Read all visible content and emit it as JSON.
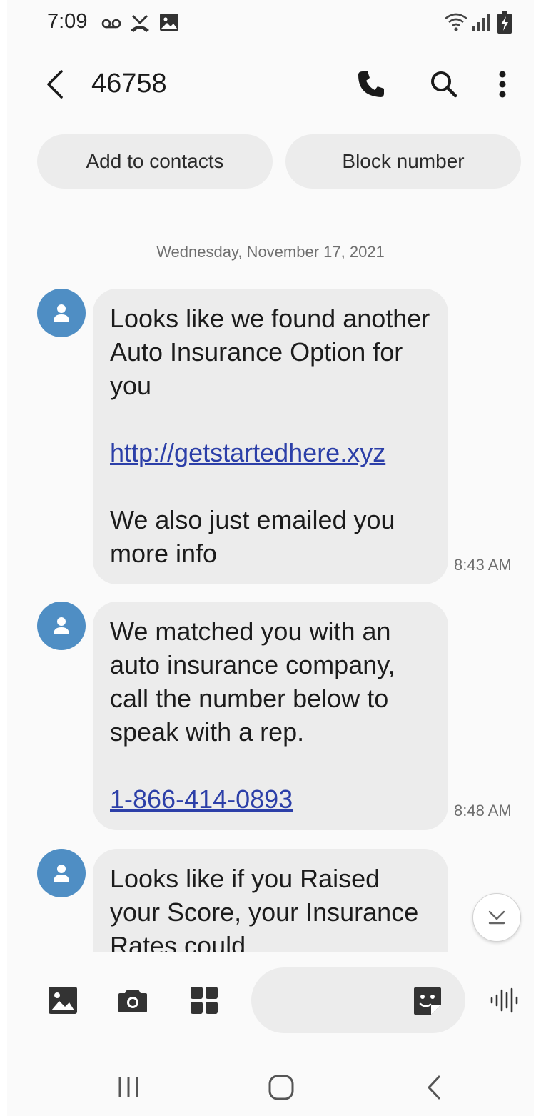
{
  "status_bar": {
    "time": "7:09",
    "icons": [
      "voicemail-icon",
      "missed-call-icon",
      "gallery-icon",
      "wifi-icon",
      "signal-icon",
      "battery-charging-icon"
    ]
  },
  "header": {
    "title": "46758",
    "icons": [
      "back-arrow-icon",
      "phone-icon",
      "search-icon",
      "more-options-icon"
    ]
  },
  "actions": {
    "add_to_contacts": "Add to contacts",
    "block_number": "Block number"
  },
  "date_header": "Wednesday, November 17, 2021",
  "messages": [
    {
      "line1": "Looks like we found another Auto Insurance Option for you",
      "link": "http://getstartedhere.xyz",
      "line2": "We also just emailed you more info",
      "time": "8:43 AM"
    },
    {
      "line1": "We matched you with an auto insurance company, call the number below to speak with a rep.",
      "link": "1-866-414-0893",
      "time": "8:48 AM"
    },
    {
      "line1": "Looks like if you Raised your Score, your Insurance Rates could"
    }
  ],
  "composer": {
    "placeholder": "",
    "icons": [
      "gallery-icon",
      "camera-icon",
      "apps-icon",
      "sticker-icon",
      "voice-recorder-icon"
    ]
  },
  "colors": {
    "avatar": "#4f8ec4",
    "bubble": "#ececec",
    "link": "#2c3fa8",
    "background": "#fafafa"
  }
}
